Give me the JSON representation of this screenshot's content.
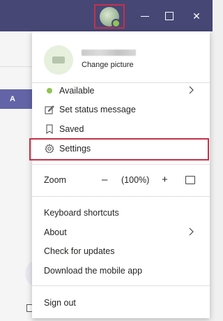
{
  "profile": {
    "change_picture": "Change picture"
  },
  "menu": {
    "status": "Available",
    "set_status": "Set status message",
    "saved": "Saved",
    "settings": "Settings",
    "zoom_label": "Zoom",
    "zoom_minus": "–",
    "zoom_value": "(100%)",
    "zoom_plus": "+",
    "keyboard_shortcuts": "Keyboard shortcuts",
    "about": "About",
    "check_updates": "Check for updates",
    "download_mobile": "Download the mobile app",
    "sign_out": "Sign out"
  },
  "window": {
    "close_glyph": "✕"
  },
  "background": {
    "strip_label": "A"
  },
  "colors": {
    "titlebar": "#464775",
    "highlight": "#c4314b",
    "available": "#92c353",
    "accent": "#6264a7"
  },
  "icons": [
    "status-available-icon",
    "edit-status-icon",
    "bookmark-icon",
    "gear-icon",
    "chevron-right-icon",
    "fit-screen-icon"
  ]
}
